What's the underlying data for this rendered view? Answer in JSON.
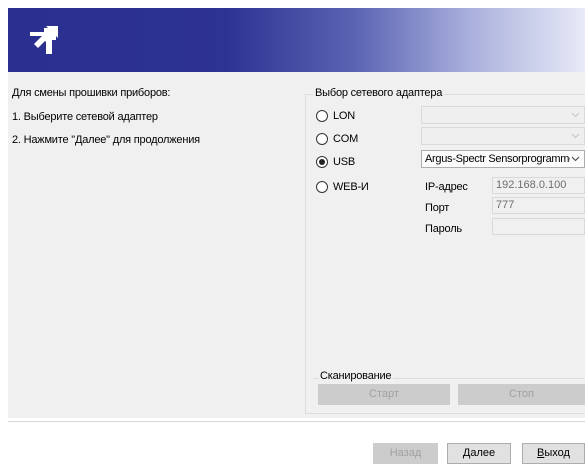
{
  "left_panel": {
    "heading": "Для смены прошивки приборов:",
    "step1": "1. Выберите сетевой адаптер",
    "step2": "2. Нажмите \"Далее\" для продолжения"
  },
  "adapter_group": {
    "title": "Выбор сетевого адаптера",
    "options": [
      {
        "label": "LON",
        "checked": false,
        "combo_value": ""
      },
      {
        "label": "COM",
        "checked": false,
        "combo_value": ""
      },
      {
        "label": "USB",
        "checked": true,
        "combo_value": "Argus-Spectr Sensorprogrammer s"
      },
      {
        "label": "WEB-И",
        "checked": false
      }
    ],
    "web": {
      "ip_label": "IP-адрес",
      "ip_value": "192.168.0.100",
      "port_label": "Порт",
      "port_value": "777",
      "password_label": "Пароль",
      "password_value": ""
    }
  },
  "scan": {
    "title": "Сканирование",
    "start_label": "Старт",
    "stop_label": "Стоп"
  },
  "footer": {
    "back_label": "Назад",
    "next_label": "Далее",
    "exit_label_underlined": "В",
    "exit_label_rest": "ыход"
  },
  "colors": {
    "banner_dark": "#2b2f8f",
    "banner_light": "#e8eaf7",
    "panel_bg": "#f0f0f0"
  },
  "icons": {
    "logo": "arrow-burst-logo",
    "combo_arrow": "chevron-down-icon"
  }
}
